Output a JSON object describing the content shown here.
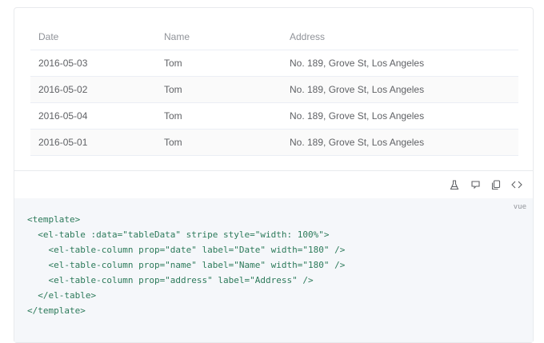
{
  "table": {
    "headers": [
      "Date",
      "Name",
      "Address"
    ],
    "rows": [
      [
        "2016-05-03",
        "Tom",
        "No. 189, Grove St, Los Angeles"
      ],
      [
        "2016-05-02",
        "Tom",
        "No. 189, Grove St, Los Angeles"
      ],
      [
        "2016-05-04",
        "Tom",
        "No. 189, Grove St, Los Angeles"
      ],
      [
        "2016-05-01",
        "Tom",
        "No. 189, Grove St, Los Angeles"
      ]
    ]
  },
  "toolbar": {
    "icons": [
      "playground-flask-icon",
      "github-icon",
      "copy-icon",
      "code-toggle-icon"
    ]
  },
  "code": {
    "lang": "vue",
    "lines": [
      "<template>",
      "  <el-table :data=\"tableData\" stripe style=\"width: 100%\">",
      "    <el-table-column prop=\"date\" label=\"Date\" width=\"180\" />",
      "    <el-table-column prop=\"name\" label=\"Name\" width=\"180\" />",
      "    <el-table-column prop=\"address\" label=\"Address\" />",
      "  </el-table>",
      "</template>"
    ]
  },
  "colors": {
    "stripe": "#fafafa",
    "border": "#ebeef5",
    "code_bg": "#f5f7fa"
  }
}
